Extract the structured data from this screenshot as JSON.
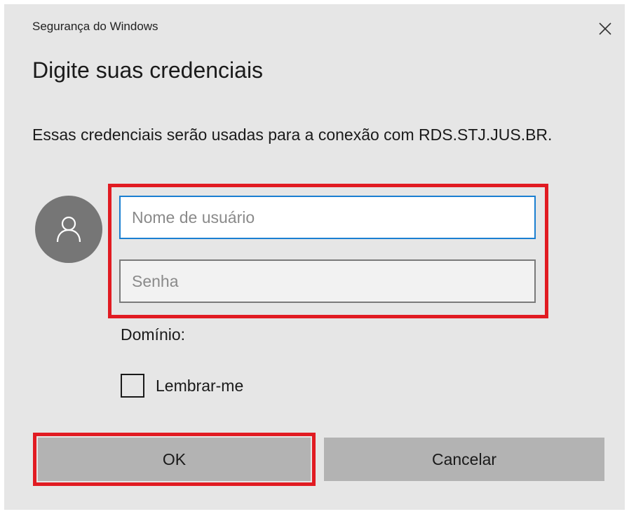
{
  "window": {
    "title": "Segurança do Windows",
    "close_icon": "close-icon"
  },
  "dialog": {
    "heading": "Digite suas credenciais",
    "description": "Essas credenciais serão usadas para a conexão com RDS.STJ.JUS.BR.",
    "avatar_icon": "user-icon"
  },
  "form": {
    "username_placeholder": "Nome de usuário",
    "username_value": "",
    "password_placeholder": "Senha",
    "password_value": "",
    "domain_label": "Domínio:",
    "remember_label": "Lembrar-me",
    "remember_checked": false
  },
  "buttons": {
    "ok_label": "OK",
    "cancel_label": "Cancelar"
  },
  "colors": {
    "highlight": "#e11b22",
    "focus_border": "#1b7fd1",
    "dialog_background": "#e6e6e6",
    "button_background": "#b3b3b3",
    "avatar_background": "#767676"
  }
}
